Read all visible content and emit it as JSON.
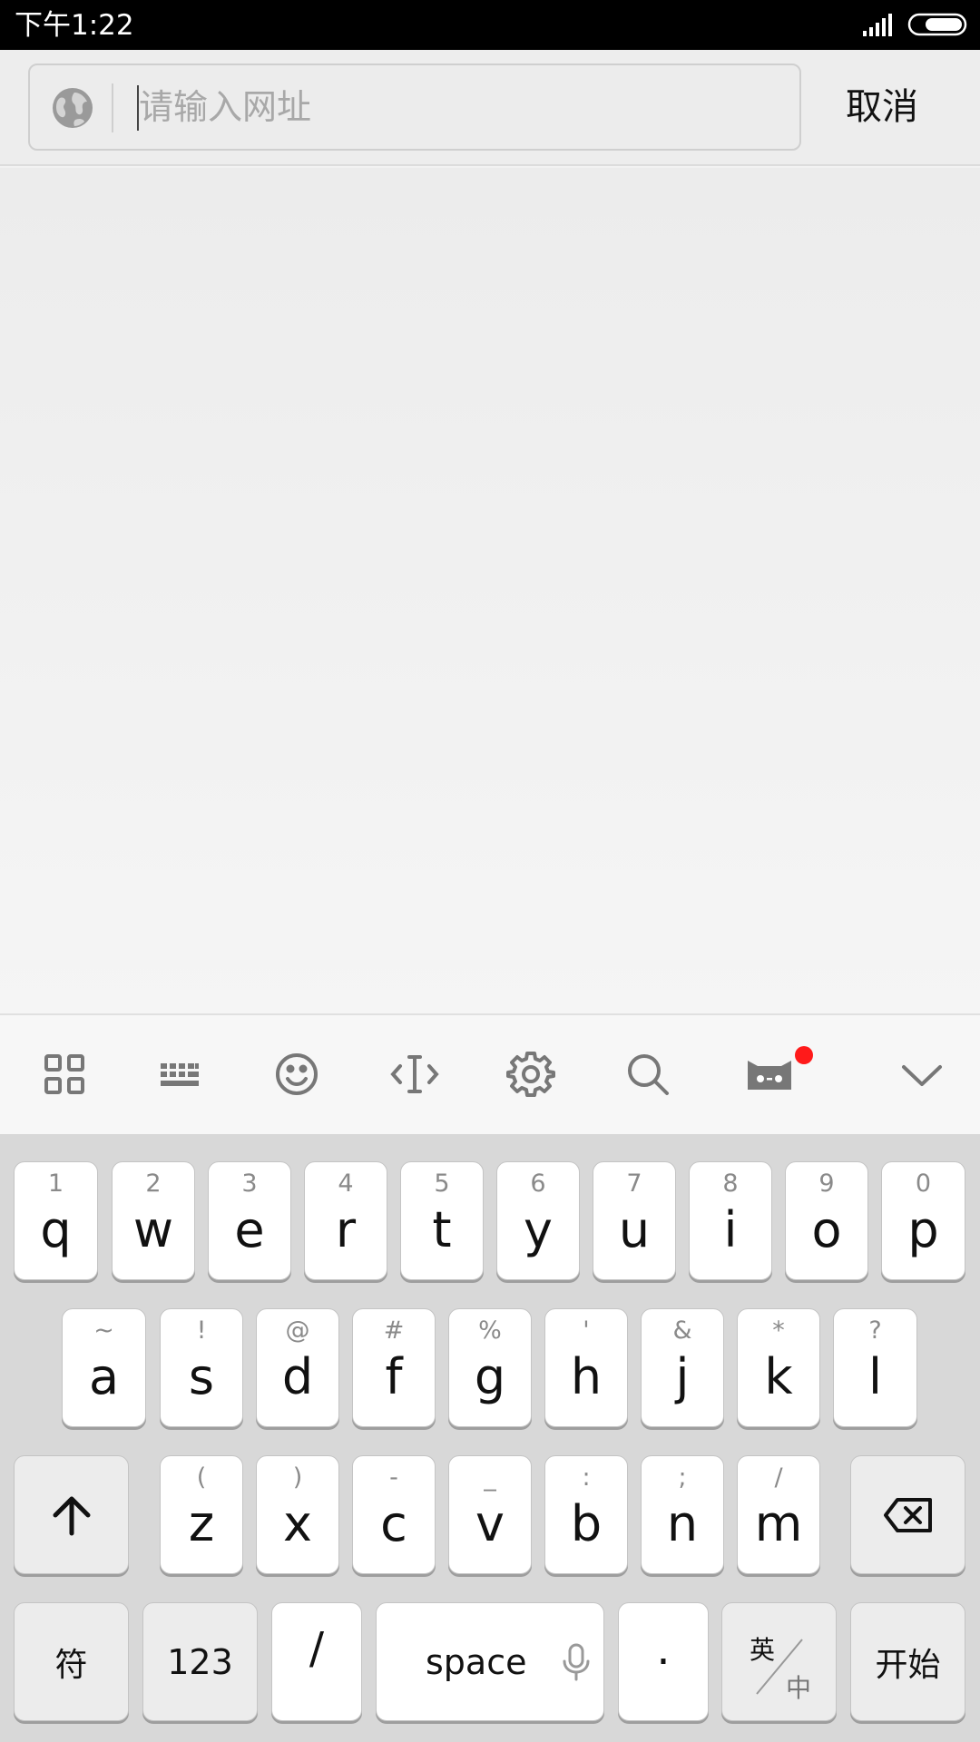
{
  "status_bar": {
    "time": "下午1:22"
  },
  "url_bar": {
    "placeholder": "请输入网址",
    "value": "",
    "cancel_label": "取消"
  },
  "toolbar": {
    "icons": [
      "grid-icon",
      "keyboard-icon",
      "emoji-icon",
      "text-cursor-icon",
      "settings-icon",
      "search-icon",
      "cat-face-icon",
      "chevron-down-icon"
    ],
    "notification_dot_color": "#ff1a1a"
  },
  "keyboard": {
    "row1": [
      {
        "sub": "1",
        "main": "q"
      },
      {
        "sub": "2",
        "main": "w"
      },
      {
        "sub": "3",
        "main": "e"
      },
      {
        "sub": "4",
        "main": "r"
      },
      {
        "sub": "5",
        "main": "t"
      },
      {
        "sub": "6",
        "main": "y"
      },
      {
        "sub": "7",
        "main": "u"
      },
      {
        "sub": "8",
        "main": "i"
      },
      {
        "sub": "9",
        "main": "o"
      },
      {
        "sub": "0",
        "main": "p"
      }
    ],
    "row2": [
      {
        "sub": "~",
        "main": "a"
      },
      {
        "sub": "!",
        "main": "s"
      },
      {
        "sub": "@",
        "main": "d"
      },
      {
        "sub": "#",
        "main": "f"
      },
      {
        "sub": "%",
        "main": "g"
      },
      {
        "sub": "'",
        "main": "h"
      },
      {
        "sub": "&",
        "main": "j"
      },
      {
        "sub": "*",
        "main": "k"
      },
      {
        "sub": "?",
        "main": "l"
      }
    ],
    "row3": [
      {
        "sub": "(",
        "main": "z"
      },
      {
        "sub": ")",
        "main": "x"
      },
      {
        "sub": "-",
        "main": "c"
      },
      {
        "sub": "_",
        "main": "v"
      },
      {
        "sub": ":",
        "main": "b"
      },
      {
        "sub": ";",
        "main": "n"
      },
      {
        "sub": "/",
        "main": "m"
      }
    ],
    "symbols_label": "符",
    "numbers_label": "123",
    "slash_label": "/",
    "space_label": "space",
    "period_label": "·",
    "lang_top": "英",
    "lang_bottom": "中",
    "go_label": "开始"
  }
}
